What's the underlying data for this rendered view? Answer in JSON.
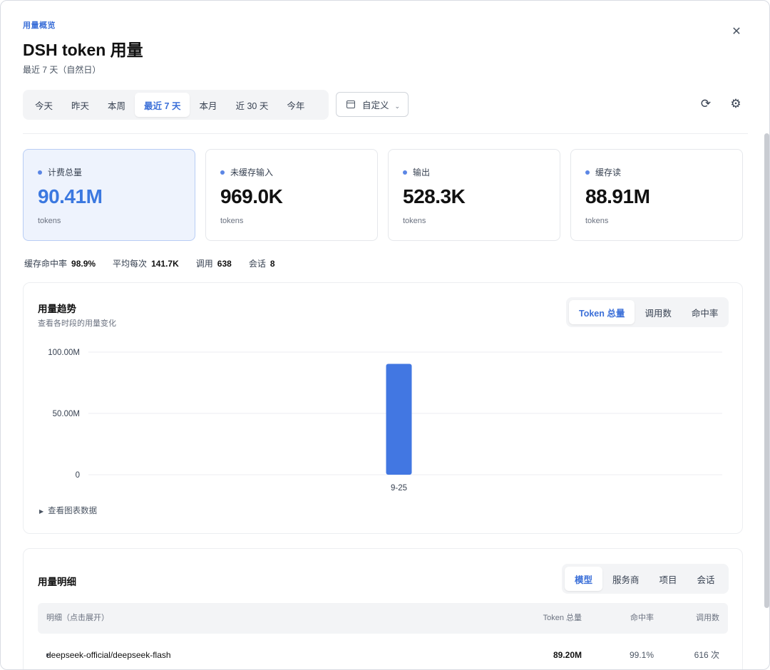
{
  "header": {
    "eyebrow": "用量概览",
    "title": "DSH token 用量",
    "subtitle": "最近 7 天（自然日）",
    "close_icon": "close-icon"
  },
  "ranges": [
    "今天",
    "昨天",
    "本周",
    "最近 7 天",
    "本月",
    "近 30 天",
    "今年"
  ],
  "active_range": "最近 7 天",
  "custom_label": "自定义",
  "toolbar": {
    "refresh_icon": "refresh-icon",
    "settings_icon": "gear-icon"
  },
  "cards": [
    {
      "label": "计费总量",
      "value": "90.41M",
      "unit": "tokens"
    },
    {
      "label": "未缓存输入",
      "value": "969.0K",
      "unit": "tokens"
    },
    {
      "label": "输出",
      "value": "528.3K",
      "unit": "tokens"
    },
    {
      "label": "缓存读",
      "value": "88.91M",
      "unit": "tokens"
    }
  ],
  "stats": [
    {
      "label": "缓存命中率",
      "value": "98.9%"
    },
    {
      "label": "平均每次",
      "value": "141.7K"
    },
    {
      "label": "调用",
      "value": "638"
    },
    {
      "label": "会话",
      "value": "8"
    }
  ],
  "trend": {
    "title": "用量趋势",
    "subtitle": "查看各时段的用量变化",
    "tabs": [
      "Token 总量",
      "调用数",
      "命中率"
    ],
    "active_tab": "Token 总量",
    "toggle_label": "查看图表数据"
  },
  "chart_data": {
    "type": "bar",
    "categories": [
      "9-25"
    ],
    "values": [
      90410000
    ],
    "ylim": [
      0,
      100000000
    ],
    "yticks": [
      {
        "value": 0,
        "label": "0"
      },
      {
        "value": 50000000,
        "label": "50.00M"
      },
      {
        "value": 100000000,
        "label": "100.00M"
      }
    ],
    "grid": true,
    "bar_color": "#4277e2"
  },
  "detail": {
    "title": "用量明细",
    "tabs": [
      "模型",
      "服务商",
      "项目",
      "会话"
    ],
    "active_tab": "模型",
    "columns": {
      "name": "明细（点击展开）",
      "tokens": "Token 总量",
      "hit": "命中率",
      "calls": "调用数"
    },
    "rows": [
      {
        "name": "deepseek-official/deepseek-flash",
        "tokens": "89.20M",
        "hit": "99.1%",
        "calls": "616 次"
      }
    ]
  }
}
